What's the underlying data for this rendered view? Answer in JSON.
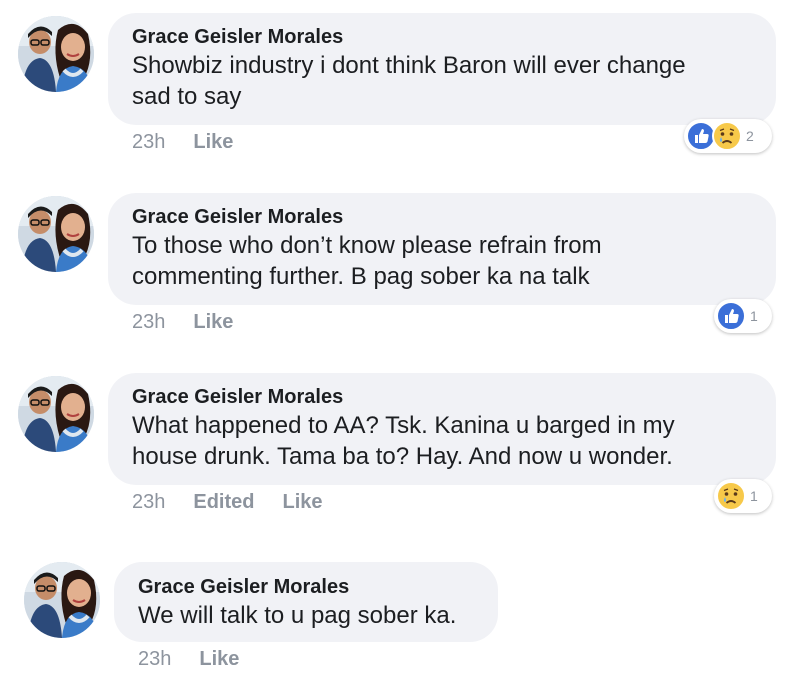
{
  "comments": [
    {
      "author": "Grace Geisler Morales",
      "lines": [
        "Showbiz industry i dont think Baron will ever change",
        "sad to say"
      ],
      "time": "23h",
      "actions": [
        "Like"
      ],
      "reactions": [
        "like-icon",
        "sad-icon"
      ],
      "reaction_count": "2"
    },
    {
      "author": "Grace Geisler Morales",
      "lines": [
        "To those who don’t know please refrain from",
        "commenting further. B pag sober ka na talk"
      ],
      "time": "23h",
      "actions": [
        "Like"
      ],
      "reactions": [
        "like-icon"
      ],
      "reaction_count": "1"
    },
    {
      "author": "Grace Geisler Morales",
      "lines": [
        "What happened to AA? Tsk. Kanina u barged in my",
        "house drunk. Tama ba to? Hay. And now u wonder."
      ],
      "time": "23h",
      "actions": [
        "Edited",
        "Like"
      ],
      "reactions": [
        "sad-icon"
      ],
      "reaction_count": "1"
    },
    {
      "author": "Grace Geisler Morales",
      "lines": [
        "We will talk to u pag sober ka."
      ],
      "time": "23h",
      "actions": [
        "Like"
      ]
    }
  ],
  "colors": {
    "bubble": "#f1f2f6",
    "like_blue": "#3b6fd8",
    "sad_yellow": "#f7c94a",
    "meta_gray": "#8d949e"
  }
}
